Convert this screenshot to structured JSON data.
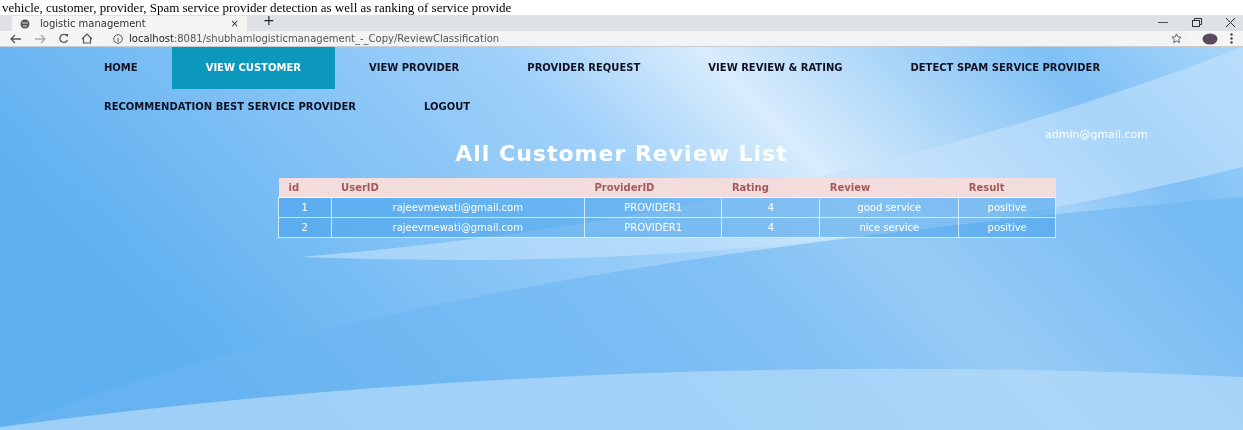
{
  "document_text": "vehicle, customer, provider, Spam service provider detection as well as ranking of service provide",
  "browser": {
    "tab_title": "logistic management",
    "tab_close": "×",
    "new_tab": "+",
    "url_host": "localhost",
    "url_rest": ":8081/shubhamlogisticmanagement_-_Copy/ReviewClassification"
  },
  "nav": [
    {
      "label": "HOME",
      "selected": false
    },
    {
      "label": "VIEW CUSTOMER",
      "selected": true
    },
    {
      "label": "VIEW PROVIDER",
      "selected": false
    },
    {
      "label": "PROVIDER REQUEST",
      "selected": false
    },
    {
      "label": "VIEW REVIEW & RATING",
      "selected": false
    },
    {
      "label": "DETECT SPAM SERVICE PROVIDER",
      "selected": false
    },
    {
      "label": "RECOMMENDATION BEST SERVICE PROVIDER",
      "selected": false
    },
    {
      "label": "LOGOUT",
      "selected": false
    }
  ],
  "user_email": "admin@gmail.com",
  "heading": "All Customer Review List",
  "table": {
    "columns": [
      "id",
      "UserID",
      "ProviderID",
      "Rating",
      "Review",
      "Result"
    ],
    "rows": [
      [
        "1",
        "rajeevmewati@gmail.com",
        "PROVIDER1",
        "4",
        "good service",
        "positive"
      ],
      [
        "2",
        "rajeevmewati@gmail.com",
        "PROVIDER1",
        "4",
        "nice service",
        "positive"
      ]
    ]
  }
}
